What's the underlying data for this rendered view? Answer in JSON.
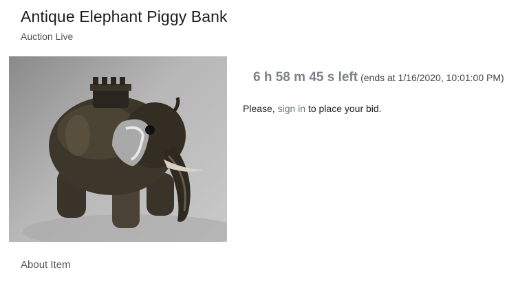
{
  "item": {
    "title": "Antique Elephant Piggy Bank",
    "status": "Auction Live",
    "image_alt": "Antique Elephant Piggy Bank"
  },
  "auction": {
    "countdown": "6 h 58 m 45 s left",
    "ends_at": "(ends at 1/16/2020, 10:01:00 PM)"
  },
  "bid_prompt": {
    "prefix": "Please, ",
    "link": "sign in",
    "suffix": " to place your bid."
  },
  "tabs": {
    "about": "About Item"
  },
  "colors": {
    "countdown": "#7b8289",
    "link": "#6c7680"
  }
}
